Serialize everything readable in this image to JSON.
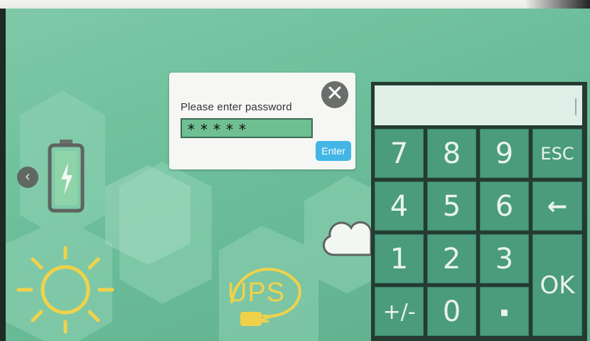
{
  "background_icons": {
    "ups_label": "UPS"
  },
  "password_dialog": {
    "prompt": "Please enter password",
    "masked_value": "*****",
    "enter_label": "Enter",
    "close_icon": "close-x"
  },
  "keypad": {
    "display_value": "",
    "keys": {
      "k7": "7",
      "k8": "8",
      "k9": "9",
      "esc": "ESC",
      "k4": "4",
      "k5": "5",
      "k6": "6",
      "backspace": "←",
      "k1": "1",
      "k2": "2",
      "k3": "3",
      "ok": "OK",
      "sign": "+/-",
      "k0": "0",
      "dot": "▪"
    }
  },
  "nav": {
    "back_icon": "chevron-left"
  },
  "colors": {
    "screen_bg": "#6dbf9b",
    "keypad_key": "#4b9b7e",
    "enter_button": "#43b6e6",
    "icon_yellow": "#f0d24a"
  }
}
